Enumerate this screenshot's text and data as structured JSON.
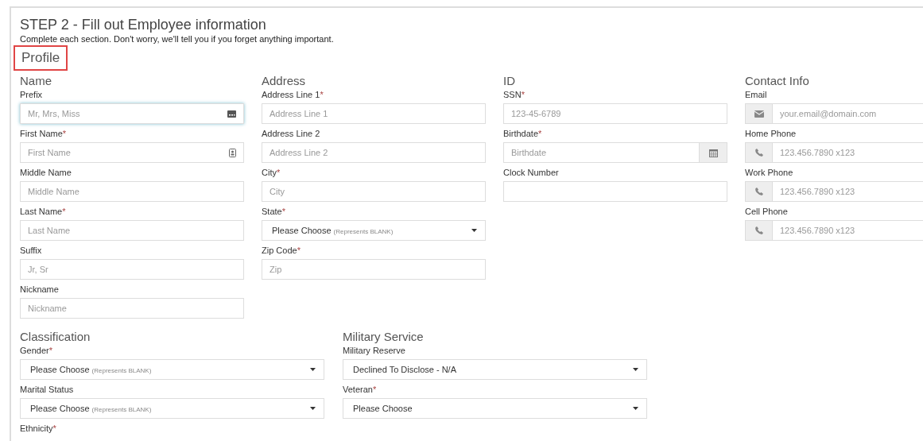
{
  "header": {
    "title": "STEP 2 - Fill out Employee information",
    "subtitle": "Complete each section. Don't worry, we'll tell you if you forget anything important.",
    "section": "Profile",
    "section_highlighted": true
  },
  "columns": [
    {
      "title": "Name",
      "fields": [
        {
          "kind": "autofill",
          "label": "Prefix",
          "placeholder": "Mr, Mrs, Miss",
          "focused": true
        },
        {
          "kind": "autofill",
          "label": "First Name",
          "mark": "*",
          "placeholder": "First Name",
          "focused": false
        },
        {
          "kind": "text",
          "label": "Middle Name",
          "placeholder": "Middle Name"
        },
        {
          "kind": "text",
          "label": "Last Name",
          "mark": "*",
          "placeholder": "Last Name"
        },
        {
          "kind": "text",
          "label": "Suffix",
          "placeholder": "Jr, Sr"
        },
        {
          "kind": "text",
          "label": "Nickname",
          "placeholder": "Nickname"
        }
      ]
    },
    {
      "title": "Address",
      "fields": [
        {
          "kind": "text",
          "label": "Address Line 1",
          "mark": "*",
          "placeholder": "Address Line 1"
        },
        {
          "kind": "text",
          "label": "Address Line 2",
          "placeholder": "Address Line 2"
        },
        {
          "kind": "text",
          "label": "City",
          "mark": "*",
          "placeholder": "City"
        },
        {
          "kind": "select",
          "label": "State",
          "mark": "*",
          "value": "Please Choose",
          "hint": "(Represents BLANK)"
        },
        {
          "kind": "text",
          "label": "Zip Code",
          "mark": "*",
          "placeholder": "Zip"
        }
      ]
    },
    {
      "title": "ID",
      "fields": [
        {
          "kind": "text",
          "label": "SSN",
          "mark": "*",
          "placeholder": "123-45-6789"
        },
        {
          "kind": "date",
          "label": "Birthdate",
          "mark": "*",
          "placeholder": "Birthdate"
        },
        {
          "kind": "text",
          "label": "Clock Number"
        }
      ]
    },
    {
      "title": "Contact Info",
      "fields": [
        {
          "kind": "email",
          "label": "Email",
          "placeholder": "your.email@domain.com"
        },
        {
          "kind": "phone",
          "label": "Home Phone",
          "placeholder": "123.456.7890 x123"
        },
        {
          "kind": "phone",
          "label": "Work Phone",
          "placeholder": "123.456.7890 x123"
        },
        {
          "kind": "phone",
          "label": "Cell Phone",
          "placeholder": "123.456.7890 x123"
        }
      ]
    }
  ],
  "lower_columns": [
    {
      "title": "Classification",
      "fields": [
        {
          "kind": "select",
          "label": "Gender",
          "mark": "*",
          "value": "Please Choose",
          "hint": "(Represents BLANK)"
        },
        {
          "kind": "select",
          "label": "Marital Status",
          "value": "Please Choose",
          "hint": "(Represents BLANK)"
        },
        {
          "kind": "label",
          "label": "Ethnicity",
          "mark": "*"
        }
      ]
    },
    {
      "title": "Military Service",
      "fields": [
        {
          "kind": "select",
          "label": "Military Reserve",
          "value": "Declined To Disclose - N/A"
        },
        {
          "kind": "select",
          "label": "Veteran",
          "mark": "*",
          "value": "Please Choose"
        }
      ]
    }
  ]
}
